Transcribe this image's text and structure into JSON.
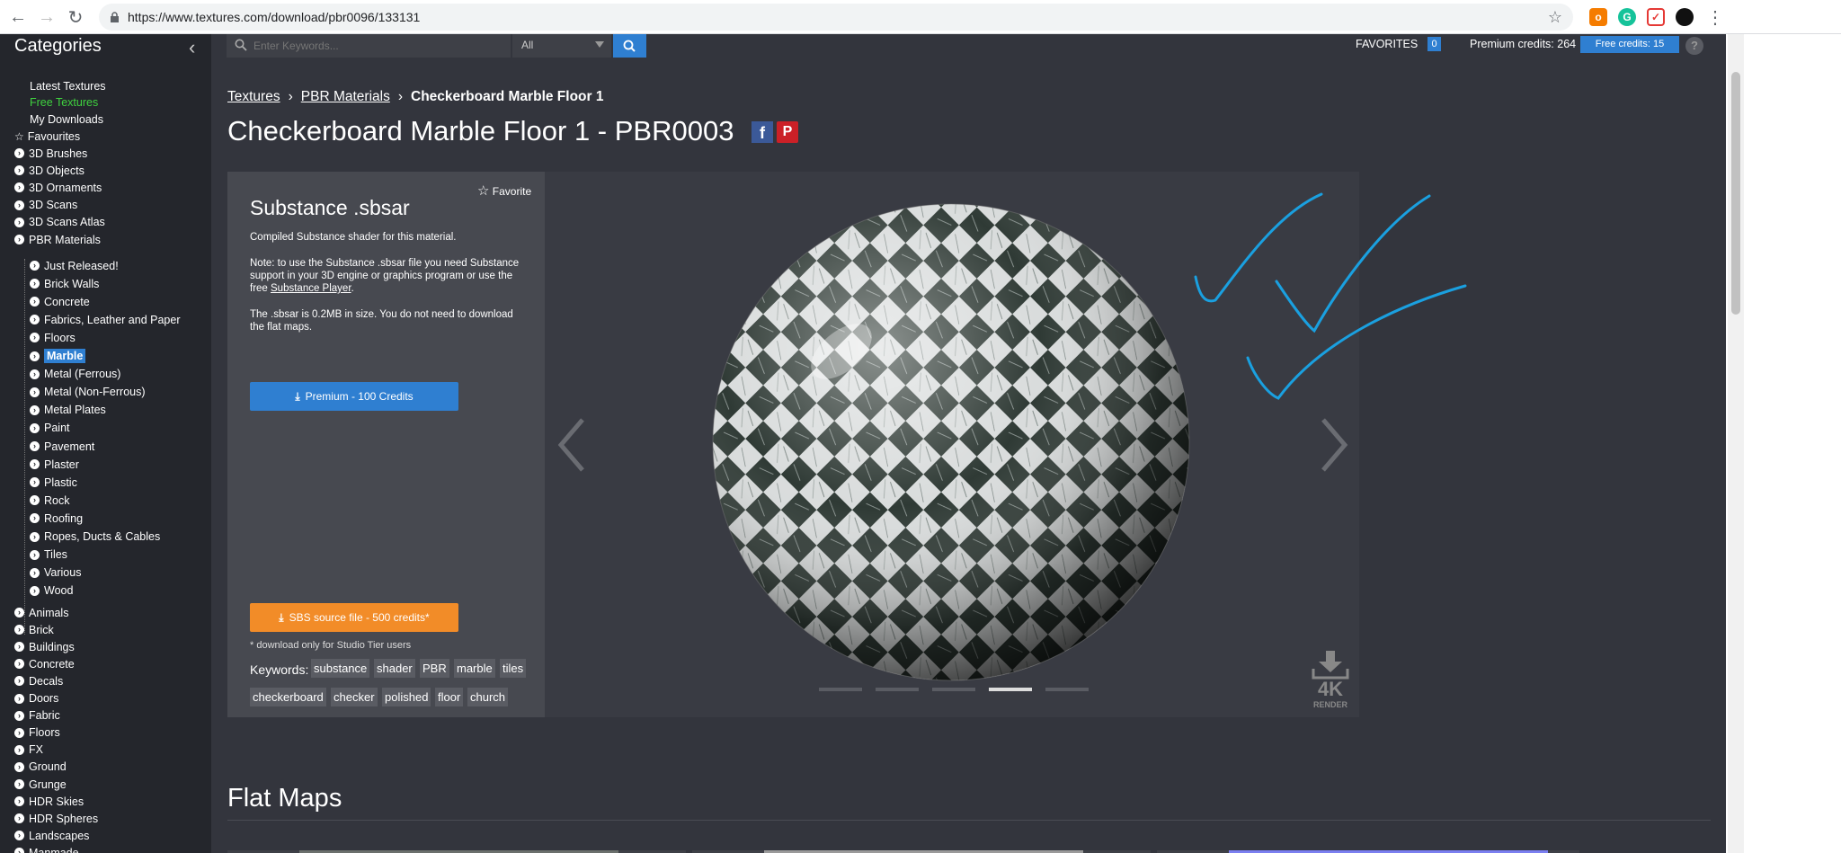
{
  "browser": {
    "url": "https://www.textures.com/download/pbr0096/133131",
    "ext_badge": "o"
  },
  "sidebar": {
    "title": "Categories",
    "top_links": [
      "Latest Textures",
      "Free Textures",
      "My Downloads"
    ],
    "favourites": "Favourites",
    "main": [
      "3D Brushes",
      "3D Objects",
      "3D Ornaments",
      "3D Scans",
      "3D Scans Atlas",
      "PBR Materials"
    ],
    "pbr_sub": [
      "Just Released!",
      "Brick Walls",
      "Concrete",
      "Fabrics, Leather and Paper",
      "Floors",
      "Marble",
      "Metal (Ferrous)",
      "Metal (Non-Ferrous)",
      "Metal Plates",
      "Paint",
      "Pavement",
      "Plaster",
      "Plastic",
      "Rock",
      "Roofing",
      "Ropes, Ducts & Cables",
      "Tiles",
      "Various",
      "Wood"
    ],
    "active_sub": "Marble",
    "more": [
      "Animals",
      "Brick",
      "Buildings",
      "Concrete",
      "Decals",
      "Doors",
      "Fabric",
      "Floors",
      "FX",
      "Ground",
      "Grunge",
      "HDR Skies",
      "HDR Spheres",
      "Landscapes",
      "Manmade"
    ]
  },
  "topbar": {
    "search_placeholder": "Enter Keywords...",
    "select_value": "All",
    "favorites_label": "FAVORITES",
    "favorites_count": "0",
    "premium_credits": "Premium credits: 264",
    "free_credits": "Free credits: 15",
    "help": "?"
  },
  "breadcrumb": {
    "items": [
      "Textures",
      "PBR Materials",
      "Checkerboard Marble Floor 1"
    ]
  },
  "page_title": "Checkerboard Marble Floor 1 - PBR0003",
  "social": {
    "facebook": "f",
    "pinterest": "P"
  },
  "panel": {
    "favorite": "Favorite",
    "title": "Substance .sbsar",
    "desc": "Compiled Substance shader for this material.",
    "note_a": "Note: to use the Substance .sbsar file you need Substance support in your 3D engine or graphics program or use the free ",
    "note_link": "Substance Player",
    "note_b": ".",
    "size_note": "The .sbsar is 0.2MB in size. You do not need to download the flat maps.",
    "premium_btn": "Premium - 100 Credits",
    "sbs_btn": "SBS source file - 500 credits*",
    "studio_note": "* download only for Studio Tier users",
    "keywords_label": "Keywords:",
    "keywords": [
      "substance",
      "shader",
      "PBR",
      "marble",
      "tiles",
      "checkerboard",
      "checker",
      "polished",
      "floor",
      "church"
    ]
  },
  "viewer": {
    "slides": 5,
    "active_slide": 4,
    "render_label": "4K",
    "render_sub": "RENDER"
  },
  "section": {
    "flat_maps": "Flat Maps"
  },
  "colors": {
    "accent": "#2f7fd1",
    "orange": "#f28c28",
    "free_green": "#3fd23f",
    "annotation": "#1aa0e0"
  }
}
